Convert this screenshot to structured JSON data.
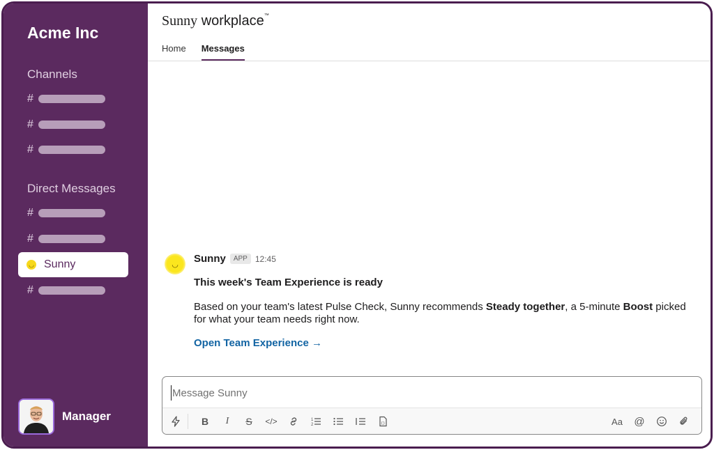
{
  "sidebar": {
    "workspace_name": "Acme Inc",
    "channels_title": "Channels",
    "direct_messages_title": "Direct Messages",
    "active_dm": {
      "label": "Sunny",
      "icon": "sun-icon"
    },
    "profile": {
      "name": "Manager"
    }
  },
  "header": {
    "brand_primary": "Sunny",
    "brand_secondary": "workplace",
    "brand_mark": "™",
    "tabs": [
      {
        "label": "Home",
        "active": false
      },
      {
        "label": "Messages",
        "active": true
      }
    ]
  },
  "message": {
    "sender": "Sunny",
    "badge": "APP",
    "time": "12:45",
    "title": "This week's Team Experience is ready",
    "body_before": "Based on your team's latest Pulse Check, Sunny recommends ",
    "body_bold_1": "Steady together",
    "body_mid": ", a 5-minute ",
    "body_bold_2": "Boost",
    "body_after": " picked for what your team needs right now.",
    "link_text": "Open Team Experience →"
  },
  "composer": {
    "placeholder": "Message Sunny",
    "value": "",
    "toolbar_icons": [
      "lightning-icon",
      "bold-icon",
      "italic-icon",
      "strikethrough-icon",
      "code-icon",
      "link-icon",
      "numbered-list-icon",
      "bulleted-list-icon",
      "indent-list-icon",
      "code-block-icon",
      "text-format-icon",
      "mention-icon",
      "emoji-icon",
      "attachment-icon"
    ]
  },
  "colors": {
    "sidebar_bg": "#5b2a5f",
    "frame_border": "#4a1d4f",
    "link": "#1264a3",
    "sun": "#f7d81c"
  }
}
